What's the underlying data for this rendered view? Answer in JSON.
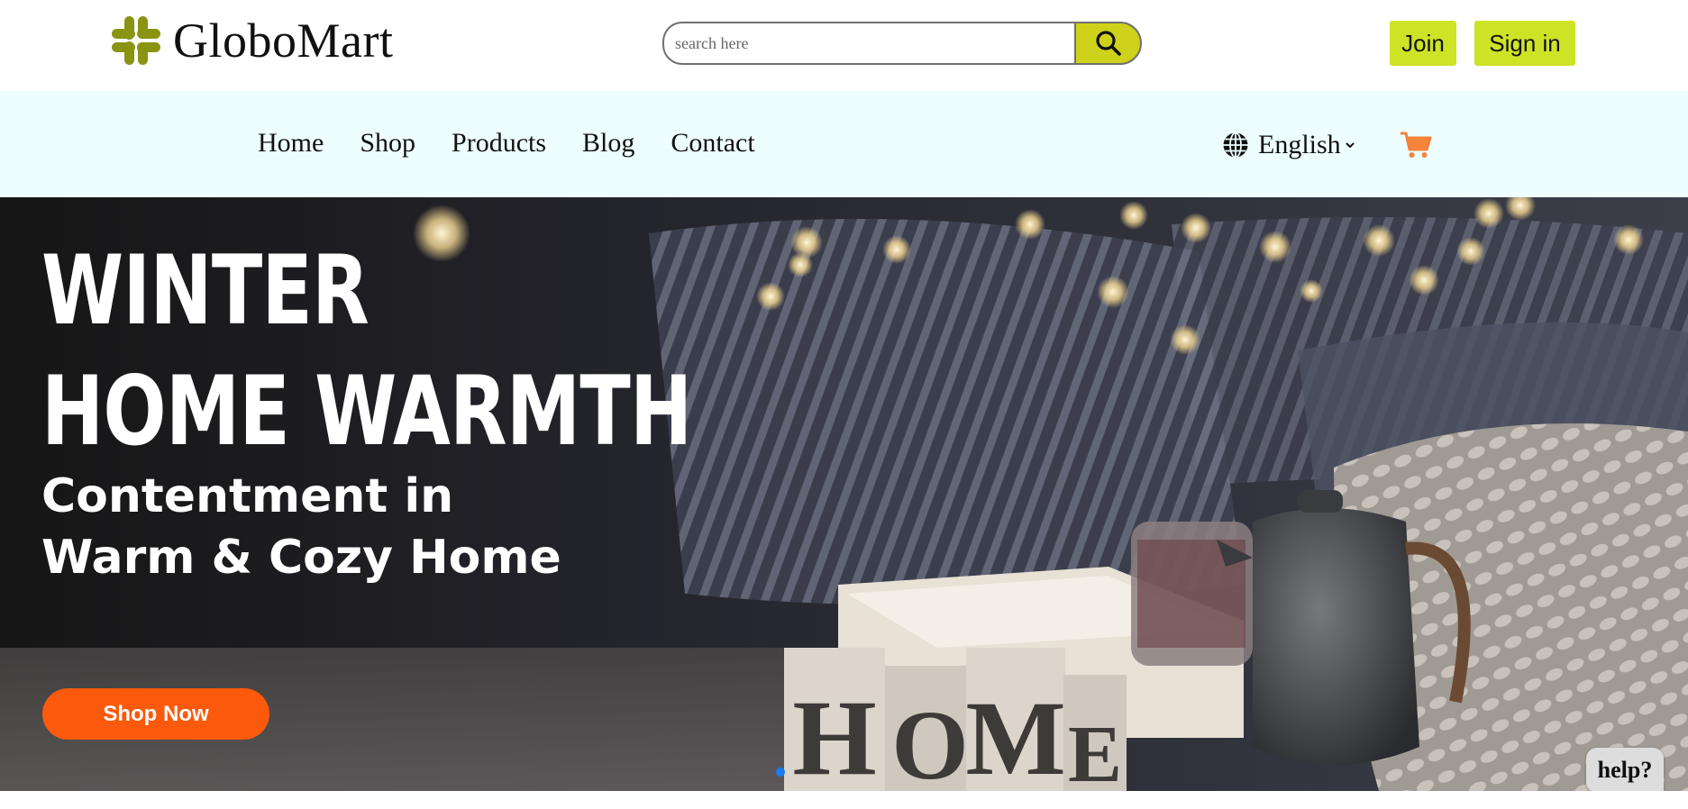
{
  "brand": {
    "name": "GloboMart",
    "logo_icon": "slack-like-grid-icon",
    "logo_color": "#8a9413"
  },
  "search": {
    "placeholder": "search here",
    "button_icon": "search-icon",
    "button_color": "#cfd21a"
  },
  "auth": {
    "join_label": "Join",
    "signin_label": "Sign in",
    "button_color": "#cde326"
  },
  "nav": {
    "links": [
      {
        "label": "Home"
      },
      {
        "label": "Shop"
      },
      {
        "label": "Products"
      },
      {
        "label": "Blog"
      },
      {
        "label": "Contact"
      }
    ],
    "language": {
      "icon": "globe-icon",
      "label": "English",
      "chevron": "chevron-down-icon"
    },
    "cart_icon": "cart-icon",
    "cart_color": "#f5833a",
    "background": "#eefeff"
  },
  "hero": {
    "title_line1": "WINTER",
    "title_line2": "HOME WARMTH",
    "subtitle_line1": "Contentment in",
    "subtitle_line2": "Warm & Cozy Home",
    "cta_label": "Shop Now",
    "cta_color": "#fb5a0c",
    "blocks_text": "HOME",
    "slide_count": 1,
    "active_slide": 1
  },
  "help": {
    "label": "help?"
  }
}
